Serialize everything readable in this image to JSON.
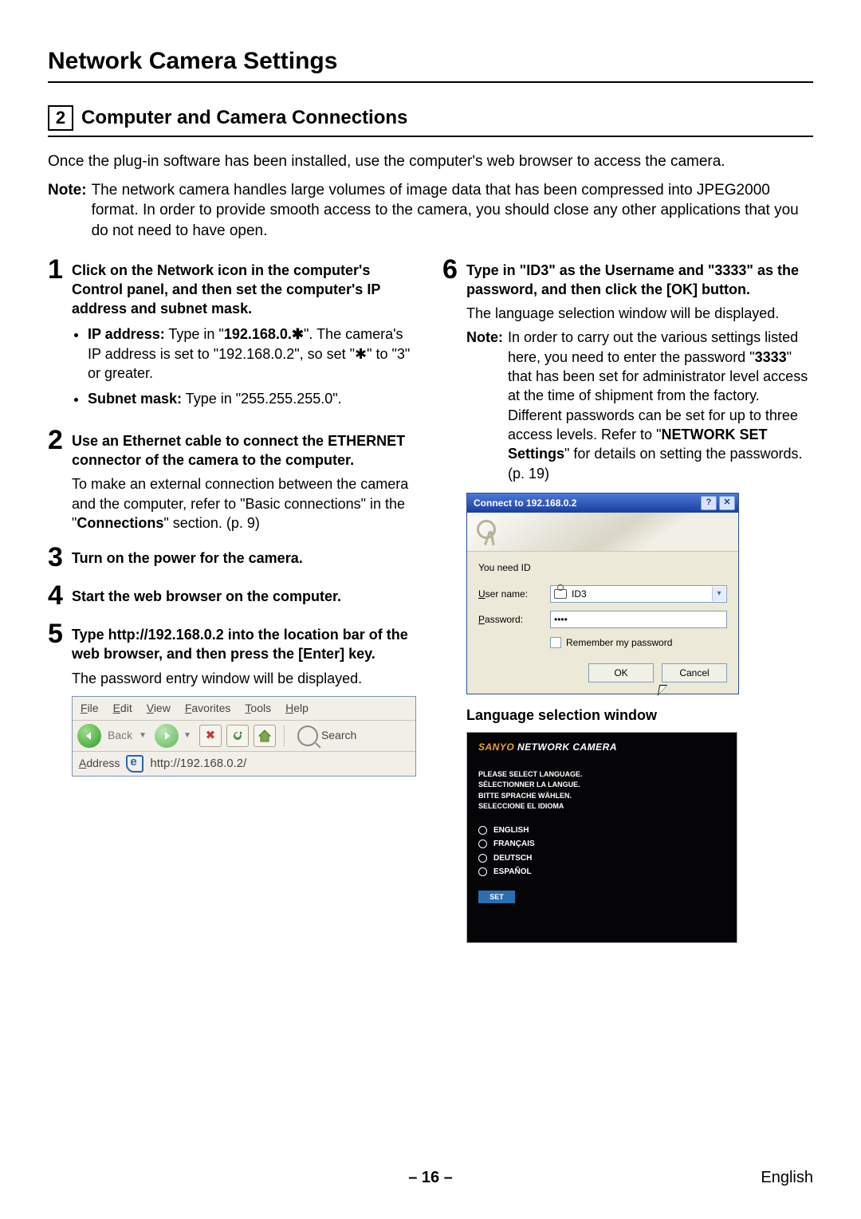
{
  "page_title": "Network Camera Settings",
  "section": {
    "num": "2",
    "title": "Computer and Camera Connections"
  },
  "intro": "Once the plug-in software has been installed, use the computer's web browser to access the camera.",
  "top_note": {
    "label": "Note:",
    "text": "The network camera handles large volumes of image data that has been compressed into JPEG2000 format. In order to provide smooth access to the camera, you should close any other applications that you do not need to have open."
  },
  "step1": {
    "num": "1",
    "head": "Click on the Network icon in the computer's Control panel, and then set the computer's IP address and subnet mask.",
    "ip_label": "IP address:",
    "ip_text_a": " Type in \"",
    "ip_value": "192.168.0.✱",
    "ip_text_b": "\". The camera's IP address is set to \"192.168.0.2\", so set \"✱\" to \"3\" or greater.",
    "sm_label": "Subnet mask:",
    "sm_text": " Type in \"255.255.255.0\"."
  },
  "step2": {
    "num": "2",
    "head": "Use an Ethernet cable to connect the ETHERNET connector of the camera to the computer.",
    "desc_a": "To make an external connection between the camera and the computer, refer to \"Basic connections\" in the \"",
    "desc_bold": "Connections",
    "desc_b": "\" section. (p. 9)"
  },
  "step3": {
    "num": "3",
    "head": "Turn on the power for the camera."
  },
  "step4": {
    "num": "4",
    "head": "Start the web browser on the computer."
  },
  "step5": {
    "num": "5",
    "head": "Type http://192.168.0.2 into the location bar of the web browser, and then press the [Enter] key.",
    "desc": "The password entry window will be displayed."
  },
  "browser": {
    "menu": {
      "file": "File",
      "edit": "Edit",
      "view": "View",
      "favorites": "Favorites",
      "tools": "Tools",
      "help": "Help"
    },
    "back": "Back",
    "search": "Search",
    "address_label": "Address",
    "url": "http://192.168.0.2/"
  },
  "step6": {
    "num": "6",
    "head": "Type in \"ID3\" as the Username and \"3333\" as the password, and then click the [OK] button.",
    "desc": "The language selection window will be displayed.",
    "note_label": "Note:",
    "note_a": "In order to carry out the various settings listed here, you need to enter the password \"",
    "note_pw": "3333",
    "note_b": "\" that has been set for administrator level access at the time of shipment from the factory. Different passwords can be set for up to three access levels. Refer to \"",
    "note_link": "NETWORK SET Settings",
    "note_c": "\" for details on setting the passwords. (p. 19)"
  },
  "dialog": {
    "title": "Connect to 192.168.0.2",
    "prompt": "You need ID",
    "user_label": "User name:",
    "user_value": "ID3",
    "pass_label": "Password:",
    "pass_value": "••••",
    "remember": "Remember my password",
    "ok": "OK",
    "cancel": "Cancel"
  },
  "lang_caption": "Language selection window",
  "lang_window": {
    "brand_a": "SANYO ",
    "brand_b": "NETWORK CAMERA",
    "msg1": "PLEASE SELECT LANGUAGE.",
    "msg2": "SÉLECTIONNER LA LANGUE.",
    "msg3": "BITTE SPRACHE WÄHLEN.",
    "msg4": "SELECCIONE EL IDIOMA",
    "opt1": "ENGLISH",
    "opt2": "FRANÇAIS",
    "opt3": "DEUTSCH",
    "opt4": "ESPAÑOL",
    "set": "SET"
  },
  "footer": {
    "page": "– 16 –",
    "lang": "English"
  }
}
